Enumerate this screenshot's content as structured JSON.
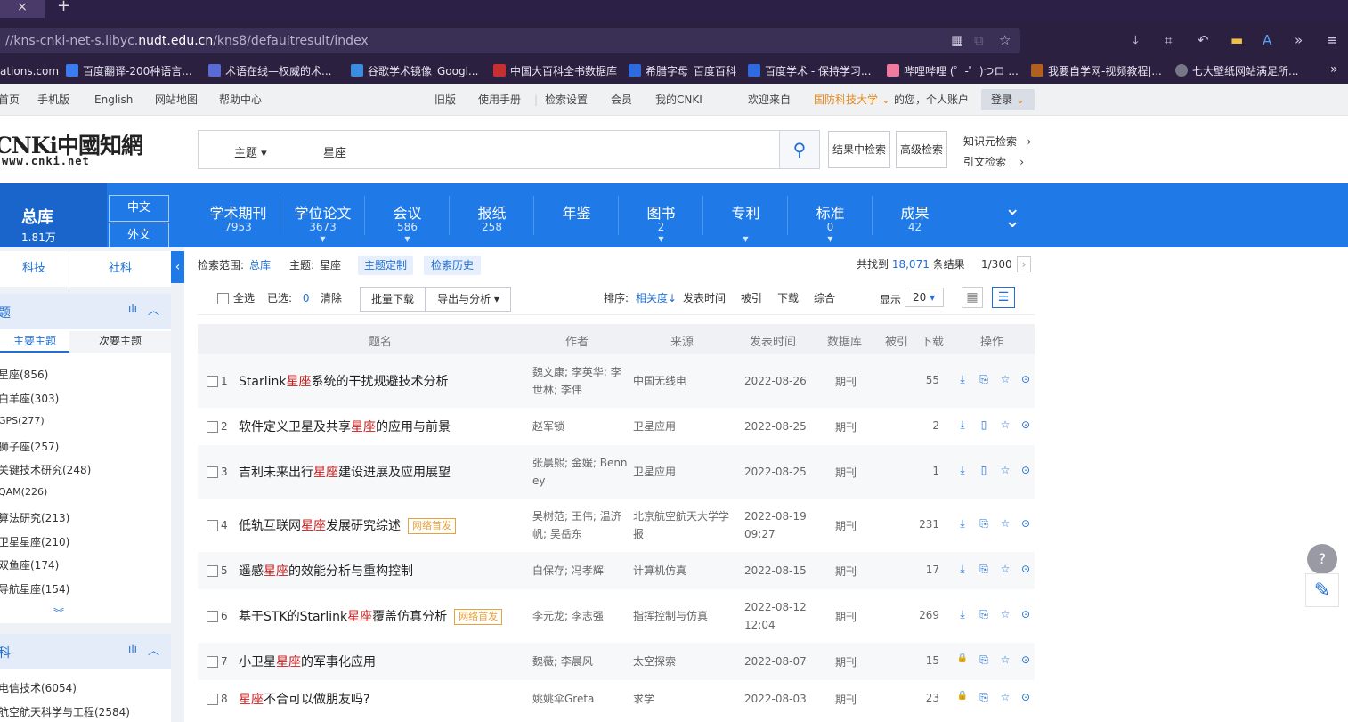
{
  "browser": {
    "tab_close": "×",
    "new_tab": "+",
    "url_prefix": "//kns-cnki-net-s.libyc.",
    "url_domain": "nudt.edu.cn",
    "url_path": "/kns8/defaultresult/index",
    "bookmarks": [
      {
        "label": "ations.com",
        "color": "#2b2040"
      },
      {
        "label": "百度翻译-200种语言...",
        "color": "#3b7cf0"
      },
      {
        "label": "术语在线—权威的术...",
        "color": "#5a6bd8"
      },
      {
        "label": "谷歌学术镜像_Googl...",
        "color": "#3a8de0"
      },
      {
        "label": "中国大百科全书数据库",
        "color": "#c73030"
      },
      {
        "label": "希腊字母_百度百科",
        "color": "#2e6be0"
      },
      {
        "label": "百度学术 - 保持学习...",
        "color": "#2e6be0"
      },
      {
        "label": "哔哩哔哩 (゜-゜)つロ ...",
        "color": "#f07aa0"
      },
      {
        "label": "我要自学网-视频教程|...",
        "color": "#b06020"
      },
      {
        "label": "七大壁纸网站满足所...",
        "color": "#777788"
      }
    ]
  },
  "topnav": {
    "left": [
      "首页",
      "手机版",
      "English",
      "网站地图",
      "帮助中心"
    ],
    "mid": [
      "旧版",
      "使用手册",
      "检索设置",
      "会员",
      "我的CNKI"
    ],
    "welcome": "欢迎来自",
    "org": "国防科技大学",
    "greeting": "的您，个人账户",
    "login": "登录"
  },
  "header": {
    "logo_main": "CNKi中國知網",
    "logo_sub": "www.cnki.net",
    "search_field": "主题",
    "search_value": "星座",
    "btn_in_result": "结果中检索",
    "btn_advanced": "高级检索",
    "link_knowledge": "知识元检索",
    "link_citation": "引文检索"
  },
  "categories": {
    "total_label": "总库",
    "total_count": "1.81万",
    "lang_cn": "中文",
    "lang_foreign": "外文",
    "items": [
      {
        "name": "学术期刊",
        "count": "7953",
        "arrow": ""
      },
      {
        "name": "学位论文",
        "count": "3673",
        "arrow": "▼"
      },
      {
        "name": "会议",
        "count": "586",
        "arrow": "▼"
      },
      {
        "name": "报纸",
        "count": "258",
        "arrow": ""
      },
      {
        "name": "年鉴",
        "count": "",
        "arrow": ""
      },
      {
        "name": "图书",
        "count": "2",
        "arrow": "▼"
      },
      {
        "name": "专利",
        "count": "",
        "arrow": "▼"
      },
      {
        "name": "标准",
        "count": "0",
        "arrow": "▼"
      },
      {
        "name": "成果",
        "count": "42",
        "arrow": ""
      }
    ]
  },
  "left": {
    "tab_tech": "科技",
    "tab_social": "社科",
    "facet1_title": "题",
    "sub_main": "主要主题",
    "sub_secondary": "次要主题",
    "facet1_items": [
      "星座(856)",
      "白羊座(303)",
      "GPS(277)",
      "狮子座(257)",
      "关键技术研究(248)",
      "QAM(226)",
      "算法研究(213)",
      "卫星星座(210)",
      "双鱼座(174)",
      "导航星座(154)"
    ],
    "facet2_title": "科",
    "facet2_items": [
      "电信技术(6054)",
      "航空航天科学与工程(2584)"
    ]
  },
  "results": {
    "scope_label": "检索范围:",
    "scope_value": "总库",
    "topic_label": "主题:",
    "topic_value": "星座",
    "btn_custom": "主题定制",
    "btn_history": "检索历史",
    "found_pre": "共找到",
    "found_count": "18,071",
    "found_post": "条结果",
    "page": "1/300",
    "select_all": "全选",
    "selected_label": "已选:",
    "selected_count": "0",
    "clear": "清除",
    "batch_download": "批量下载",
    "export": "导出与分析",
    "sort_label": "排序:",
    "sort_relevance": "相关度",
    "sort_date": "发表时间",
    "sort_cited": "被引",
    "sort_download": "下载",
    "sort_overall": "综合",
    "show_label": "显示",
    "show_value": "20",
    "col_title": "题名",
    "col_author": "作者",
    "col_source": "来源",
    "col_date": "发表时间",
    "col_db": "数据库",
    "col_cited": "被引",
    "col_download": "下载",
    "col_ops": "操作",
    "badge_online": "网络首发",
    "rows": [
      {
        "n": "1",
        "pre": "Starlink",
        "hl": "星座",
        "post": "系统的干扰规避技术分析",
        "badge": "",
        "a1": "魏文康; 李英华; 李",
        "a2": "世林; 李伟",
        "s1": "中国无线电",
        "s2": "",
        "d1": "2022-08-26",
        "d2": "",
        "db": "期刊",
        "dl": "55",
        "ops": [
          "⤓",
          "⎘",
          "☆",
          "⊙"
        ]
      },
      {
        "n": "2",
        "pre": "软件定义卫星及共享",
        "hl": "星座",
        "post": "的应用与前景",
        "badge": "",
        "a1": "赵军锁",
        "a2": "",
        "s1": "卫星应用",
        "s2": "",
        "d1": "2022-08-25",
        "d2": "",
        "db": "期刊",
        "dl": "2",
        "ops": [
          "⤓",
          "▯",
          "☆",
          "⊙"
        ]
      },
      {
        "n": "3",
        "pre": "吉利未来出行",
        "hl": "星座",
        "post": "建设进展及应用展望",
        "badge": "",
        "a1": "张晨熙; 金媛; Benn",
        "a2": "ey",
        "s1": "卫星应用",
        "s2": "",
        "d1": "2022-08-25",
        "d2": "",
        "db": "期刊",
        "dl": "1",
        "ops": [
          "⤓",
          "▯",
          "☆",
          "⊙"
        ]
      },
      {
        "n": "4",
        "pre": "低轨互联网",
        "hl": "星座",
        "post": "发展研究综述",
        "badge": "网络首发",
        "a1": "吴树范; 王伟; 温济",
        "a2": "帆; 吴岳东",
        "s1": "北京航空航天大学学",
        "s2": "报",
        "d1": "2022-08-19",
        "d2": "09:27",
        "db": "期刊",
        "dl": "231",
        "ops": [
          "⤓",
          "⎘",
          "☆",
          "⊙"
        ]
      },
      {
        "n": "5",
        "pre": "遥感",
        "hl": "星座",
        "post": "的效能分析与重构控制",
        "badge": "",
        "a1": "白保存; 冯孝辉",
        "a2": "",
        "s1": "计算机仿真",
        "s2": "",
        "d1": "2022-08-15",
        "d2": "",
        "db": "期刊",
        "dl": "17",
        "ops": [
          "⤓",
          "⎘",
          "☆",
          "⊙"
        ]
      },
      {
        "n": "6",
        "pre": "基于STK的Starlink",
        "hl": "星座",
        "post": "覆盖仿真分析",
        "badge": "网络首发",
        "a1": "李元龙; 李志强",
        "a2": "",
        "s1": "指挥控制与仿真",
        "s2": "",
        "d1": "2022-08-12",
        "d2": "12:04",
        "db": "期刊",
        "dl": "269",
        "ops": [
          "⤓",
          "⎘",
          "☆",
          "⊙"
        ]
      },
      {
        "n": "7",
        "pre": "小卫星",
        "hl": "星座",
        "post": "的军事化应用",
        "badge": "",
        "a1": "魏薇; 李晨风",
        "a2": "",
        "s1": "太空探索",
        "s2": "",
        "d1": "2022-08-07",
        "d2": "",
        "db": "期刊",
        "dl": "15",
        "ops": [
          "🔒",
          "⎘",
          "☆",
          "⊙"
        ]
      },
      {
        "n": "8",
        "pre": "",
        "hl": "星座",
        "post": "不合可以做朋友吗?",
        "badge": "",
        "a1": "姚姚伞Greta",
        "a2": "",
        "s1": "求学",
        "s2": "",
        "d1": "2022-08-03",
        "d2": "",
        "db": "期刊",
        "dl": "23",
        "ops": [
          "🔒",
          "⎘",
          "☆",
          "⊙"
        ]
      }
    ]
  },
  "float": {
    "help": "?",
    "edit": "✎"
  }
}
